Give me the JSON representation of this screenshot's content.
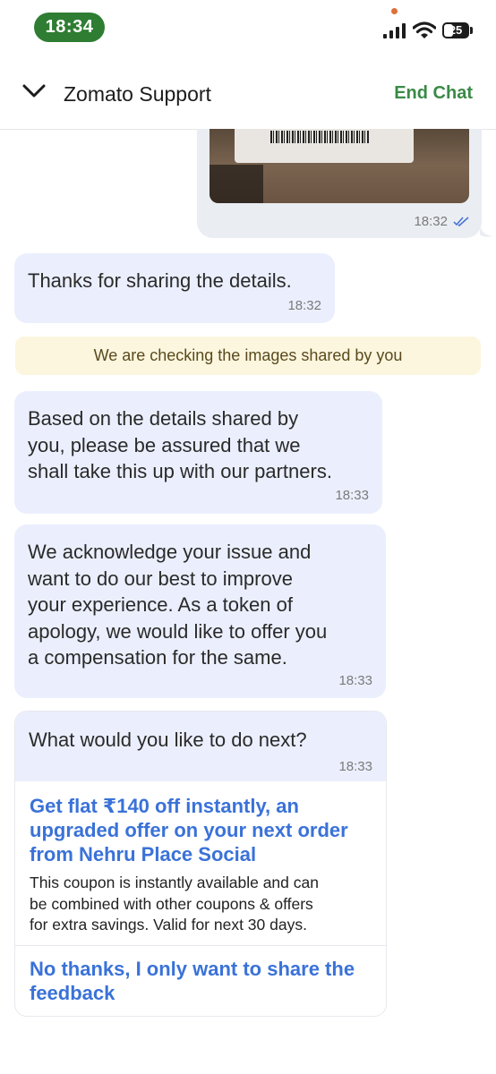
{
  "status_bar": {
    "time": "18:34",
    "battery": "25",
    "icons": [
      "signal-icon",
      "wifi-icon",
      "battery-icon"
    ]
  },
  "header": {
    "title": "Zomato Support",
    "end_chat_label": "End Chat",
    "back_icon": "chevron-down-icon"
  },
  "messages": {
    "sent_image": {
      "time": "18:32",
      "read_icon": "double-check-icon"
    },
    "thanks": {
      "text": "Thanks for sharing the details.",
      "time": "18:32"
    },
    "banner": {
      "text": "We are checking the images shared by you"
    },
    "assured": {
      "lines": [
        "Based on the details shared by",
        "you, please be assured that we",
        "shall take this up with our partners."
      ],
      "time": "18:33"
    },
    "acknowledge": {
      "lines": [
        "We acknowledge your issue and",
        "want to do our best to improve",
        "your experience. As a token of",
        "apology, we would like to offer you",
        "a compensation for the same."
      ],
      "time": "18:33"
    },
    "next": {
      "text": "What would you like to do next?",
      "time": "18:33",
      "options": [
        {
          "title_lines": [
            "Get flat ₹140 off instantly, an",
            "upgraded offer on your next order",
            "from Nehru Place Social"
          ],
          "desc_lines": [
            "This coupon is instantly available and can",
            "be combined with other coupons & offers",
            "for extra savings. Valid for next 30 days."
          ]
        },
        {
          "title_lines": [
            "No thanks, I only want to share the",
            "feedback"
          ]
        }
      ]
    }
  },
  "colors": {
    "time_pill": "#2e7d32",
    "end_chat": "#3a8a46",
    "bubble": "#ebeffd",
    "banner": "#fcf6df",
    "option_link": "#3a72d8"
  }
}
